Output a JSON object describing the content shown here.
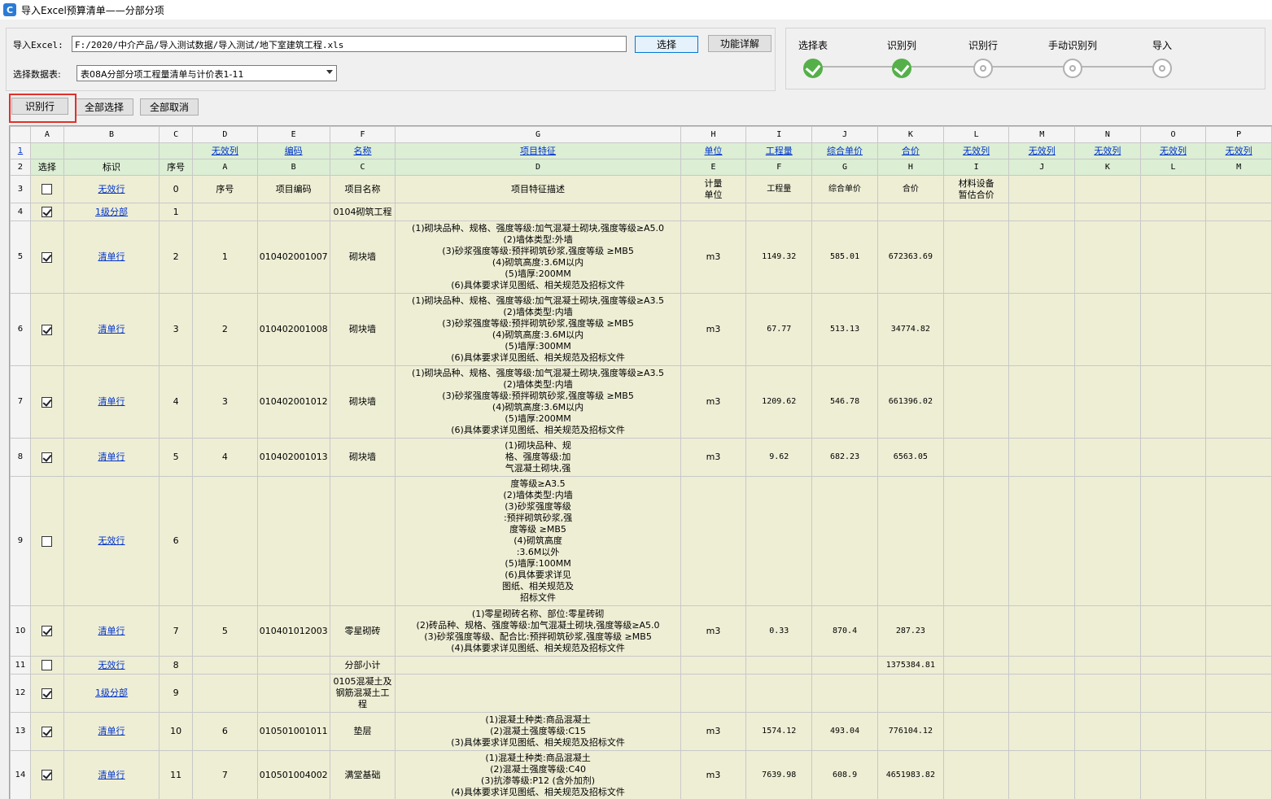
{
  "window": {
    "title": "导入Excel预算清单——分部分项",
    "icon": "app-logo-icon"
  },
  "form": {
    "excel_label": "导入Excel:",
    "excel_path": "F:/2020/中介产品/导入测试数据/导入测试/地下室建筑工程.xls",
    "choose_button": "选择",
    "detail_button": "功能详解",
    "sheet_label": "选择数据表:",
    "sheet_selected": "表08A分部分项工程量清单与计价表1-11"
  },
  "steps": [
    {
      "label": "选择表",
      "status": "done"
    },
    {
      "label": "识别列",
      "status": "done"
    },
    {
      "label": "识别行",
      "status": "todo"
    },
    {
      "label": "手动识别列",
      "status": "todo"
    },
    {
      "label": "导入",
      "status": "todo"
    }
  ],
  "toolbar": {
    "identify_rows": "识别行",
    "select_all": "全部选择",
    "deselect_all": "全部取消"
  },
  "grid": {
    "col_letters": [
      "",
      "A",
      "B",
      "C",
      "D",
      "E",
      "F",
      "G",
      "H",
      "I",
      "J",
      "K",
      "L",
      "M",
      "N",
      "O",
      "P"
    ],
    "row1_link": "1",
    "row1": [
      "",
      "",
      "",
      "无效列",
      "编码",
      "名称",
      "项目特征",
      "单位",
      "工程量",
      "综合单价",
      "合价",
      "无效列",
      "无效列",
      "无效列",
      "无效列",
      "无效列"
    ],
    "row2": [
      "选择",
      "标识",
      "序号",
      "A",
      "B",
      "C",
      "D",
      "E",
      "F",
      "G",
      "H",
      "I",
      "J",
      "K",
      "L",
      "M"
    ],
    "rows": [
      {
        "rn": "3",
        "checked": false,
        "tag": "无效行",
        "seq": "0",
        "cells": [
          "序号",
          "项目编码",
          "项目名称",
          "项目特征描述",
          "计量\n单位",
          "工程量",
          "综合单价",
          "合价",
          "材料设备\n暂估合价",
          "",
          "",
          "",
          ""
        ]
      },
      {
        "rn": "4",
        "checked": true,
        "tag": "1级分部",
        "seq": "1",
        "cells": [
          "",
          "",
          "0104砌筑工程",
          "",
          "",
          "",
          "",
          "",
          "",
          "",
          "",
          "",
          ""
        ]
      },
      {
        "rn": "5",
        "checked": true,
        "tag": "清单行",
        "seq": "2",
        "cells": [
          "1",
          "010402001007",
          "砌块墙",
          "(1)砌块品种、规格、强度等级:加气混凝土砌块,强度等级≥A5.0\n(2)墙体类型:外墙\n(3)砂浆强度等级:预拌砌筑砂浆,强度等级 ≥MB5\n(4)砌筑高度:3.6M以内\n(5)墙厚:200MM\n(6)具体要求详见图纸、相关规范及招标文件",
          "m3",
          "1149.32",
          "585.01",
          "672363.69",
          "",
          "",
          "",
          "",
          ""
        ]
      },
      {
        "rn": "6",
        "checked": true,
        "tag": "清单行",
        "seq": "3",
        "cells": [
          "2",
          "010402001008",
          "砌块墙",
          "(1)砌块品种、规格、强度等级:加气混凝土砌块,强度等级≥A3.5\n(2)墙体类型:内墙\n(3)砂浆强度等级:预拌砌筑砂浆,强度等级 ≥MB5\n(4)砌筑高度:3.6M以内\n(5)墙厚:300MM\n(6)具体要求详见图纸、相关规范及招标文件",
          "m3",
          "67.77",
          "513.13",
          "34774.82",
          "",
          "",
          "",
          "",
          ""
        ]
      },
      {
        "rn": "7",
        "checked": true,
        "tag": "清单行",
        "seq": "4",
        "cells": [
          "3",
          "010402001012",
          "砌块墙",
          "(1)砌块品种、规格、强度等级:加气混凝土砌块,强度等级≥A3.5\n(2)墙体类型:内墙\n(3)砂浆强度等级:预拌砌筑砂浆,强度等级 ≥MB5\n(4)砌筑高度:3.6M以内\n(5)墙厚:200MM\n(6)具体要求详见图纸、相关规范及招标文件",
          "m3",
          "1209.62",
          "546.78",
          "661396.02",
          "",
          "",
          "",
          "",
          ""
        ]
      },
      {
        "rn": "8",
        "checked": true,
        "tag": "清单行",
        "seq": "5",
        "cells": [
          "4",
          "010402001013",
          "砌块墙",
          "(1)砌块品种、规\n格、强度等级:加\n气混凝土砌块,强",
          "m3",
          "9.62",
          "682.23",
          "6563.05",
          "",
          "",
          "",
          "",
          ""
        ]
      },
      {
        "rn": "9",
        "checked": false,
        "tag": "无效行",
        "seq": "6",
        "cells": [
          "",
          "",
          "",
          "度等级≥A3.5\n(2)墙体类型:内墙\n(3)砂浆强度等级\n:预拌砌筑砂浆,强\n度等级 ≥MB5\n(4)砌筑高度\n:3.6M以外\n(5)墙厚:100MM\n(6)具体要求详见\n图纸、相关规范及\n招标文件",
          "",
          "",
          "",
          "",
          "",
          "",
          "",
          "",
          ""
        ]
      },
      {
        "rn": "10",
        "checked": true,
        "tag": "清单行",
        "seq": "7",
        "cells": [
          "5",
          "010401012003",
          "零星砌砖",
          "(1)零星砌砖名称、部位:零星砖砌\n(2)砖品种、规格、强度等级:加气混凝土砌块,强度等级≥A5.0\n(3)砂浆强度等级、配合比:预拌砌筑砂浆,强度等级 ≥MB5\n(4)具体要求详见图纸、相关规范及招标文件",
          "m3",
          "0.33",
          "870.4",
          "287.23",
          "",
          "",
          "",
          "",
          ""
        ]
      },
      {
        "rn": "11",
        "checked": false,
        "tag": "无效行",
        "seq": "8",
        "cells": [
          "",
          "",
          "分部小计",
          "",
          "",
          "",
          "",
          "1375384.81",
          "",
          "",
          "",
          "",
          ""
        ]
      },
      {
        "rn": "12",
        "checked": true,
        "tag": "1级分部",
        "seq": "9",
        "cells": [
          "",
          "",
          "0105混凝土及\n钢筋混凝土工\n程",
          "",
          "",
          "",
          "",
          "",
          "",
          "",
          "",
          "",
          ""
        ]
      },
      {
        "rn": "13",
        "checked": true,
        "tag": "清单行",
        "seq": "10",
        "cells": [
          "6",
          "010501001011",
          "垫层",
          "(1)混凝土种类:商品混凝土\n(2)混凝土强度等级:C15\n(3)具体要求详见图纸、相关规范及招标文件",
          "m3",
          "1574.12",
          "493.04",
          "776104.12",
          "",
          "",
          "",
          "",
          ""
        ]
      },
      {
        "rn": "14",
        "checked": true,
        "tag": "清单行",
        "seq": "11",
        "cells": [
          "7",
          "010501004002",
          "满堂基础",
          "(1)混凝土种类:商品混凝土\n(2)混凝土强度等级:C40\n(3)抗渗等级:P12 (含外加剂)\n(4)具体要求详见图纸、相关规范及招标文件",
          "m3",
          "7639.98",
          "608.9",
          "4651983.82",
          "",
          "",
          "",
          "",
          ""
        ]
      }
    ]
  }
}
